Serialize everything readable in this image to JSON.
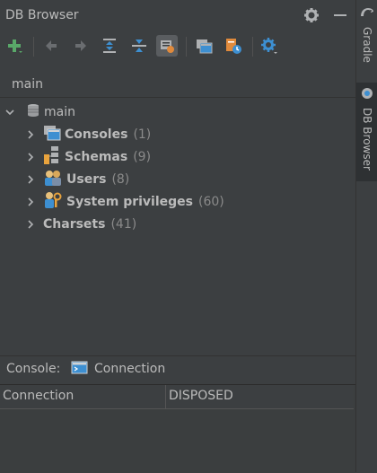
{
  "header": {
    "title": "DB Browser"
  },
  "toolbar": {
    "icons": [
      "add-icon",
      "back-icon",
      "forward-icon",
      "expand-all-icon",
      "collapse-all-icon",
      "filter-icon",
      "open-console-icon",
      "sql-history-icon",
      "settings-icon"
    ]
  },
  "connection_selector": {
    "value": "main"
  },
  "tree": {
    "root": {
      "label": "main"
    },
    "items": [
      {
        "label": "Consoles",
        "count": "(1)"
      },
      {
        "label": "Schemas",
        "count": "(9)"
      },
      {
        "label": "Users",
        "count": "(8)"
      },
      {
        "label": "System privileges",
        "count": "(60)"
      },
      {
        "label": "Charsets",
        "count": "(41)"
      }
    ]
  },
  "console": {
    "label": "Console:",
    "connection": "Connection"
  },
  "grid": {
    "col1": "Connection",
    "col2": "DISPOSED"
  },
  "sidebar": {
    "tabs": [
      {
        "label": "Gradle"
      },
      {
        "label": "DB Browser"
      }
    ]
  },
  "colors": {
    "background": "#3c3f41",
    "text": "#bbbbbb",
    "count": "#8a8a8a",
    "accent_green": "#59a869",
    "accent_blue": "#3d8fd1"
  }
}
